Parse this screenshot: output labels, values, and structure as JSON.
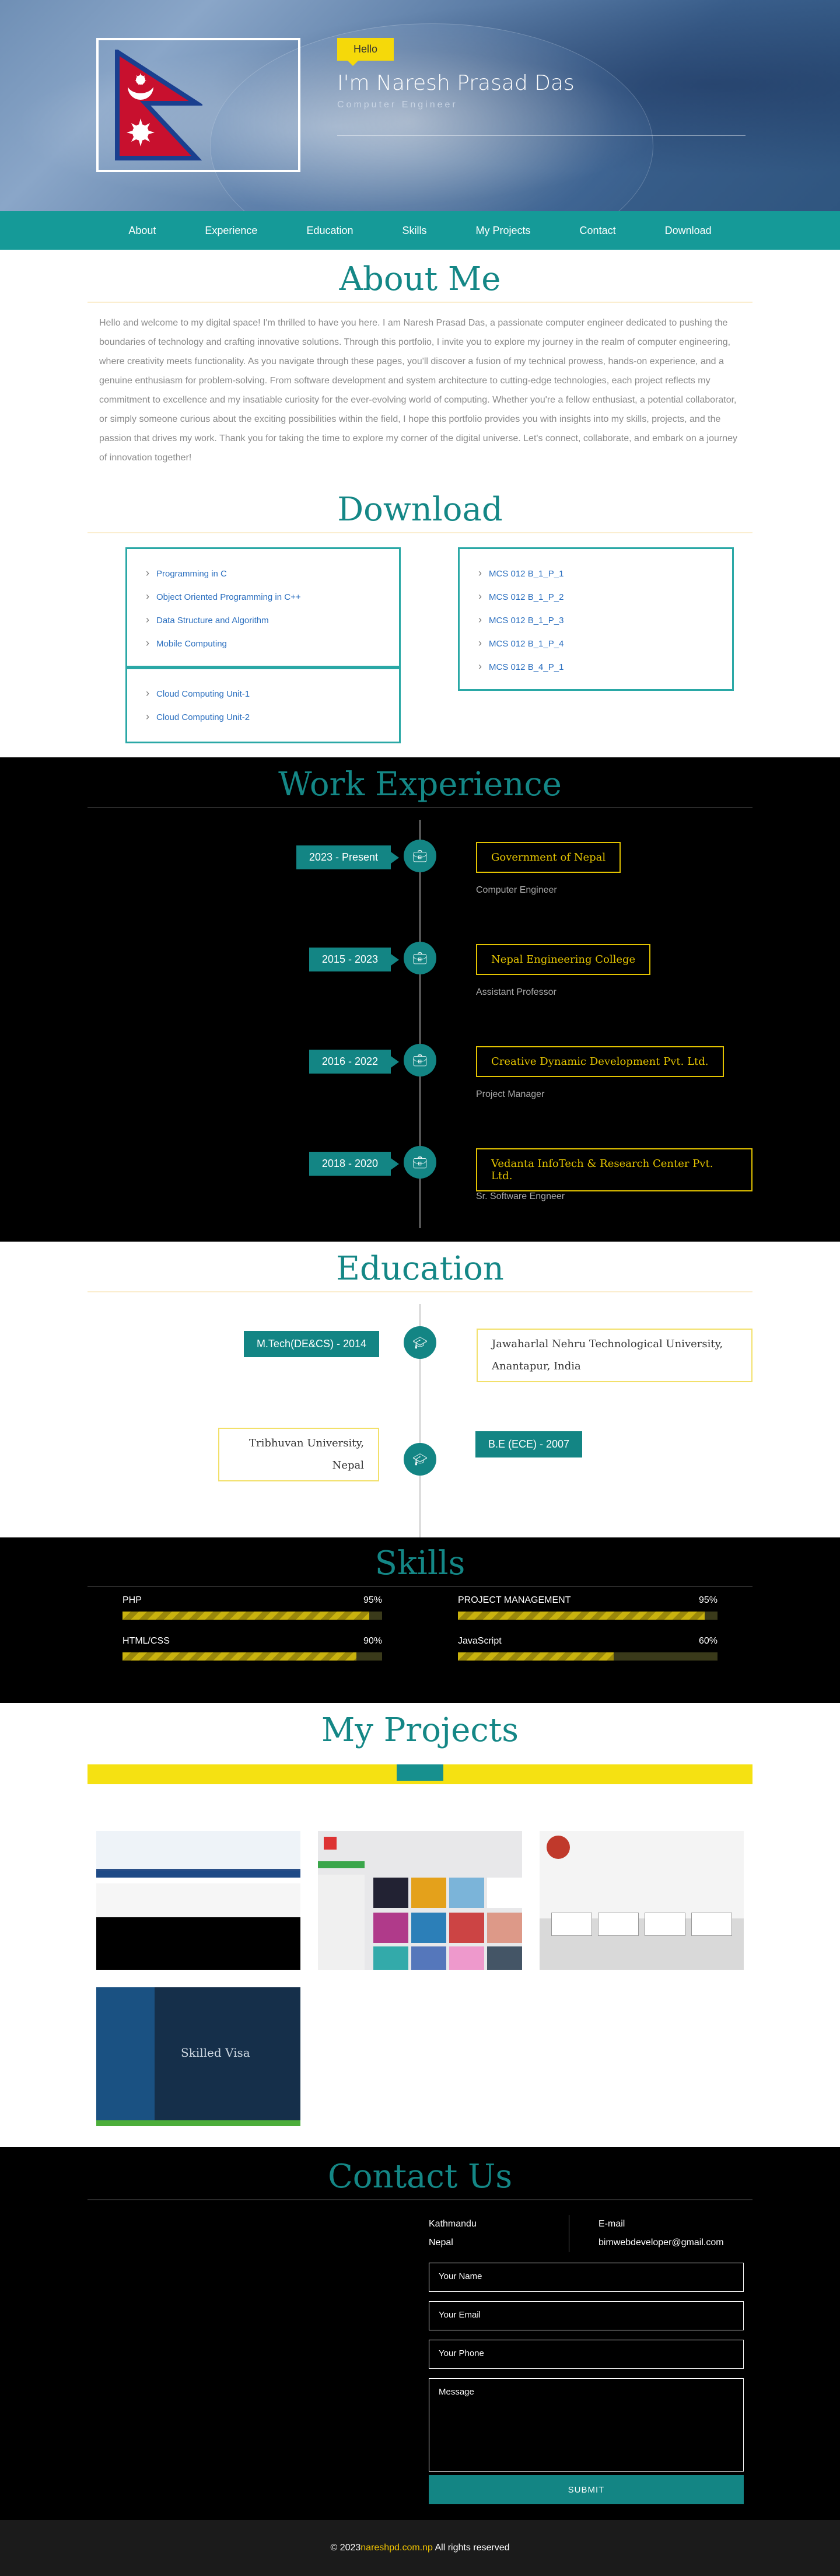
{
  "hero": {
    "badge": "Hello",
    "name": "I'm Naresh Prasad Das",
    "role": "Computer Engineer"
  },
  "nav": [
    "About",
    "Experience",
    "Education",
    "Skills",
    "My Projects",
    "Contact",
    "Download"
  ],
  "about": {
    "title": "About Me",
    "text": "Hello and welcome to my digital space! I'm thrilled to have you here. I am Naresh Prasad Das, a passionate computer engineer dedicated to pushing the boundaries of technology and crafting innovative solutions. Through this portfolio, I invite you to explore my journey in the realm of computer engineering, where creativity meets functionality. As you navigate through these pages, you'll discover a fusion of my technical prowess, hands-on experience, and a genuine enthusiasm for problem-solving. From software development and system architecture to cutting-edge technologies, each project reflects my commitment to excellence and my insatiable curiosity for the ever-evolving world of computing. Whether you're a fellow enthusiast, a potential collaborator, or simply someone curious about the exciting possibilities within the field, I hope this portfolio provides you with insights into my skills, projects, and the passion that drives my work. Thank you for taking the time to explore my corner of the digital universe. Let's connect, collaborate, and embark on a journey of innovation together!"
  },
  "download": {
    "title": "Download",
    "box1": [
      "Programming in C",
      "Object Oriented Programming in C++",
      "Data Structure and Algorithm",
      "Mobile Computing"
    ],
    "box2": [
      "Cloud Computing Unit-1",
      "Cloud Computing Unit-2"
    ],
    "box3": [
      "MCS 012 B_1_P_1",
      "MCS 012 B_1_P_2",
      "MCS 012 B_1_P_3",
      "MCS 012 B_1_P_4",
      "MCS 012 B_4_P_1"
    ]
  },
  "experience": {
    "title": "Work Experience",
    "items": [
      {
        "date": "2023 - Present",
        "company": "Government of Nepal",
        "role": "Computer Engineer"
      },
      {
        "date": "2015 - 2023",
        "company": "Nepal Engineering College",
        "role": "Assistant Professor"
      },
      {
        "date": "2016 - 2022",
        "company": "Creative Dynamic Development Pvt. Ltd.",
        "role": "Project Manager"
      },
      {
        "date": "2018 - 2020",
        "company": "Vedanta InfoTech & Research Center Pvt. Ltd.",
        "role": "Sr. Software Engneer"
      }
    ]
  },
  "education": {
    "title": "Education",
    "items": [
      {
        "degree": "M.Tech(DE&CS) - 2014",
        "school_line1": "Jawaharlal Nehru Technological University,",
        "school_line2": "Anantapur, India"
      },
      {
        "degree": "B.E (ECE) - 2007",
        "school_line1": "Tribhuvan University,",
        "school_line2": "Nepal"
      }
    ]
  },
  "skills": {
    "title": "Skills",
    "items": [
      {
        "name": "PHP",
        "percent": "95%",
        "level": 95
      },
      {
        "name": "PROJECT MANAGEMENT",
        "percent": "95%",
        "level": 95
      },
      {
        "name": "HTML/CSS",
        "percent": "90%",
        "level": 90
      },
      {
        "name": "JavaScript",
        "percent": "60%",
        "level": 60
      }
    ]
  },
  "projects": {
    "title": "My Projects",
    "project_4_text": "Skilled Visa"
  },
  "contact": {
    "title": "Contact Us",
    "address_line1": "Kathmandu",
    "address_line2": "Nepal",
    "email_label": "E-mail",
    "email": "bimwebdeveloper@gmail.com",
    "name_placeholder": "Your Name",
    "email_placeholder": "Your Email",
    "phone_placeholder": "Your Phone",
    "message_placeholder": "Message",
    "submit": "SUBMIT"
  },
  "footer": {
    "prefix": "© 2023",
    "brand": "nareshpd.com.np",
    "suffix": " All rights reserved"
  },
  "colors": {
    "teal": "#159a98",
    "accent_yellow": "#f5d90a"
  }
}
